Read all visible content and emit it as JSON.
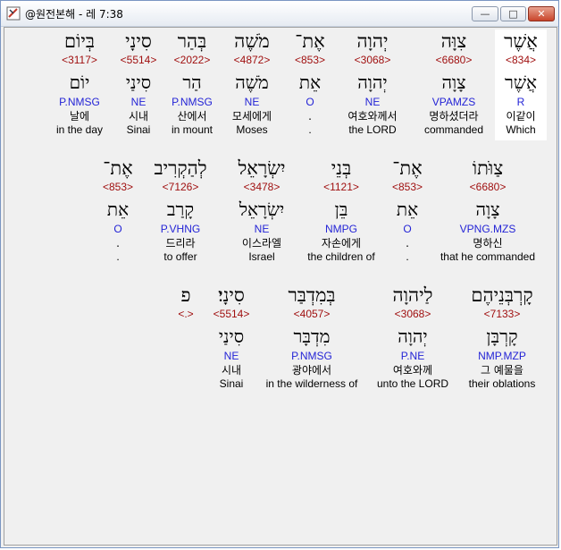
{
  "window": {
    "title": "@원전본해 - 레 7:38",
    "minimize": "—",
    "maximize": "□",
    "close": "✕"
  },
  "lines": [
    {
      "y": 0,
      "words": [
        {
          "heb": "אֲשֶׁר",
          "strong": "<834>",
          "lemma": "אֲשֶׁר",
          "morph": "R",
          "ko": "이같이",
          "en": "Which",
          "highlight": true
        },
        {
          "heb": "צִוָּה",
          "strong": "<6680>",
          "lemma": "צָוָה",
          "morph": "VPAMZS",
          "ko": "명하셨더라",
          "en": "commanded"
        },
        {
          "heb": "יְהוָה",
          "strong": "<3068>",
          "lemma": "יְהוָה",
          "morph": "NE",
          "ko": "여호와께서",
          "en": "the LORD"
        },
        {
          "heb": "אֶת־",
          "strong": "<853>",
          "lemma": "אֵת",
          "morph": "O",
          "ko": ".",
          "en": "."
        },
        {
          "heb": "מֹשֶׁה",
          "strong": "<4872>",
          "lemma": "מֹשֶׁה",
          "morph": "NE",
          "ko": "모세에게",
          "en": "Moses"
        },
        {
          "heb": "בְּהַר",
          "strong": "<2022>",
          "lemma": "הַר",
          "morph": "P.NMSG",
          "ko": "산에서",
          "en": "in mount"
        },
        {
          "heb": "סִינָי",
          "strong": "<5514>",
          "lemma": "סִינַי",
          "morph": "NE",
          "ko": "시내",
          "en": "Sinai"
        },
        {
          "heb": "בְּיוֹם",
          "strong": "<3117>",
          "lemma": "יוֹם",
          "morph": "P.NMSG",
          "ko": "날에",
          "en": "in the day"
        }
      ]
    },
    {
      "y": 1,
      "words": [
        {
          "heb": "צַוֺּתוֹ",
          "strong": "<6680>",
          "lemma": "צָוָה",
          "morph": "VPNG.MZS",
          "ko": "명하신",
          "en": "that he commanded"
        },
        {
          "heb": "אֶת־",
          "strong": "<853>",
          "lemma": "אֵת",
          "morph": "O",
          "ko": ".",
          "en": "."
        },
        {
          "heb": "בְּנֵי",
          "strong": "<1121>",
          "lemma": "בֵּן",
          "morph": "NMPG",
          "ko": "자손에게",
          "en": "the children of"
        },
        {
          "heb": "יִשְׂרָאֵל",
          "strong": "<3478>",
          "lemma": "יִשְׂרָאֵל",
          "morph": "NE",
          "ko": "이스라엘",
          "en": "Israel"
        },
        {
          "heb": "לְהַקְרִיב",
          "strong": "<7126>",
          "lemma": "קָרַב",
          "morph": "P.VHNG",
          "ko": "드리라",
          "en": "to offer"
        },
        {
          "heb": "אֶת־",
          "strong": "<853>",
          "lemma": "אֵת",
          "morph": "O",
          "ko": ".",
          "en": "."
        }
      ]
    },
    {
      "y": 2,
      "words": [
        {
          "heb": "קָרְבְּנֵיהֶם",
          "strong": "<7133>",
          "lemma": "קָרְבָּן",
          "morph": "NMP.MZP",
          "ko": "그 예물을",
          "en": "their oblations"
        },
        {
          "heb": "לַיהוָה",
          "strong": "<3068>",
          "lemma": "יְהוָה",
          "morph": "P.NE",
          "ko": "여호와께",
          "en": "unto the LORD"
        },
        {
          "heb": "בְּמִדְבַּר",
          "strong": "<4057>",
          "lemma": "מִדְבָּר",
          "morph": "P.NMSG",
          "ko": "광야에서",
          "en": "in the wilderness of"
        },
        {
          "heb": "סִינָי׃",
          "strong": "<5514>",
          "lemma": "סִינַי",
          "morph": "NE",
          "ko": "시내",
          "en": "Sinai"
        },
        {
          "heb": "פ",
          "strong": "<.>",
          "lemma": "",
          "morph": "",
          "ko": "",
          "en": ""
        }
      ]
    }
  ]
}
